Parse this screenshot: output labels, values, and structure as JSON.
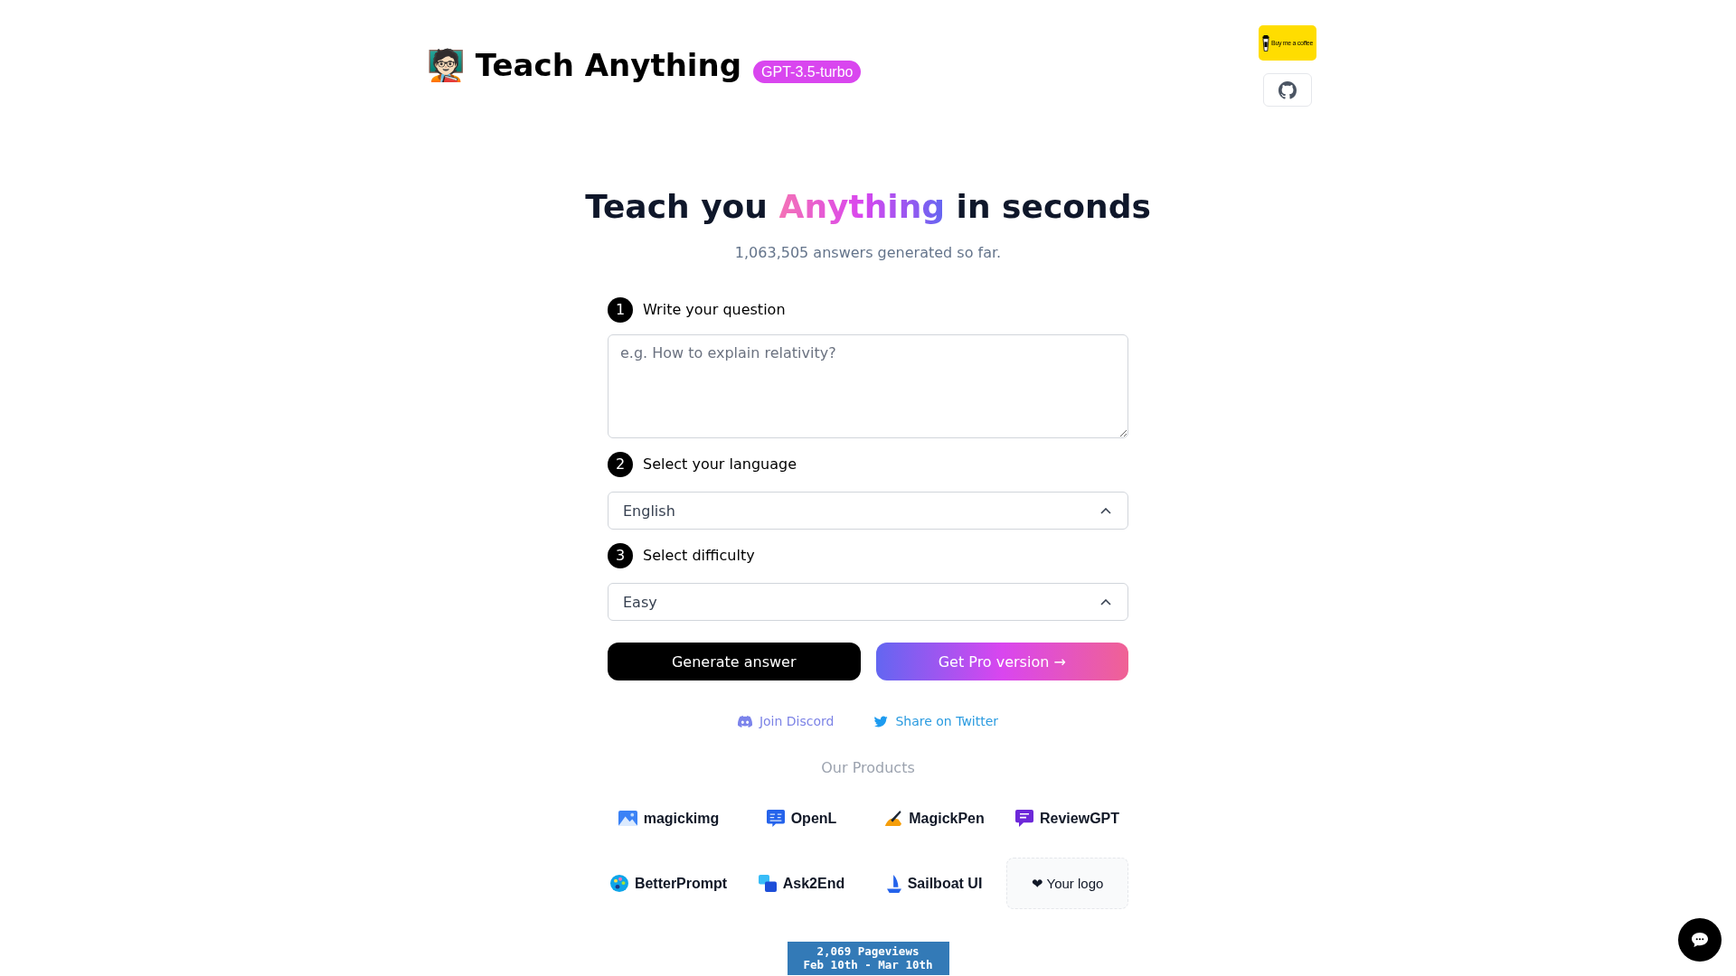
{
  "header": {
    "title": "🧑🏻‍🏫 Teach Anything",
    "model_badge": "GPT-3.5-turbo",
    "coffee_button": "Buy me a coffee"
  },
  "hero": {
    "heading": {
      "before": "Teach you",
      "highlight": "Anything",
      "after": "in seconds"
    },
    "counter": "1,063,505 answers generated so far."
  },
  "form": {
    "steps": [
      {
        "number": "1",
        "label": "Write your question",
        "kind": "textarea",
        "placeholder": "e.g. How to explain relativity?"
      },
      {
        "number": "2",
        "label": "Select your language",
        "kind": "select",
        "value": "English"
      },
      {
        "number": "3",
        "label": "Select difficulty",
        "kind": "select",
        "value": "Easy"
      }
    ],
    "buttons": [
      {
        "label": "Generate answer",
        "kind": "primary"
      },
      {
        "label": "Get Pro version →",
        "kind": "gradient"
      }
    ]
  },
  "social_links": [
    {
      "label": "Join Discord",
      "kind": "discord"
    },
    {
      "label": "Share on Twitter",
      "kind": "twitter"
    }
  ],
  "products": {
    "heading": "Our Products",
    "items": [
      {
        "label": "magickimg",
        "kind": "photo"
      },
      {
        "label": "OpenL",
        "kind": "translate"
      },
      {
        "label": "MagickPen",
        "kind": "pen"
      },
      {
        "label": "ReviewGPT",
        "kind": "chat"
      },
      {
        "label": "BetterPrompt",
        "kind": "palette"
      },
      {
        "label": "Ask2End",
        "kind": "qa"
      },
      {
        "label": "Sailboat UI",
        "kind": "sailboat"
      },
      {
        "label": "❤ Your logo",
        "kind": "slot"
      }
    ]
  },
  "pageviews": {
    "count": "2,069 Pageviews",
    "range": "Feb 10th - Mar 10th"
  }
}
